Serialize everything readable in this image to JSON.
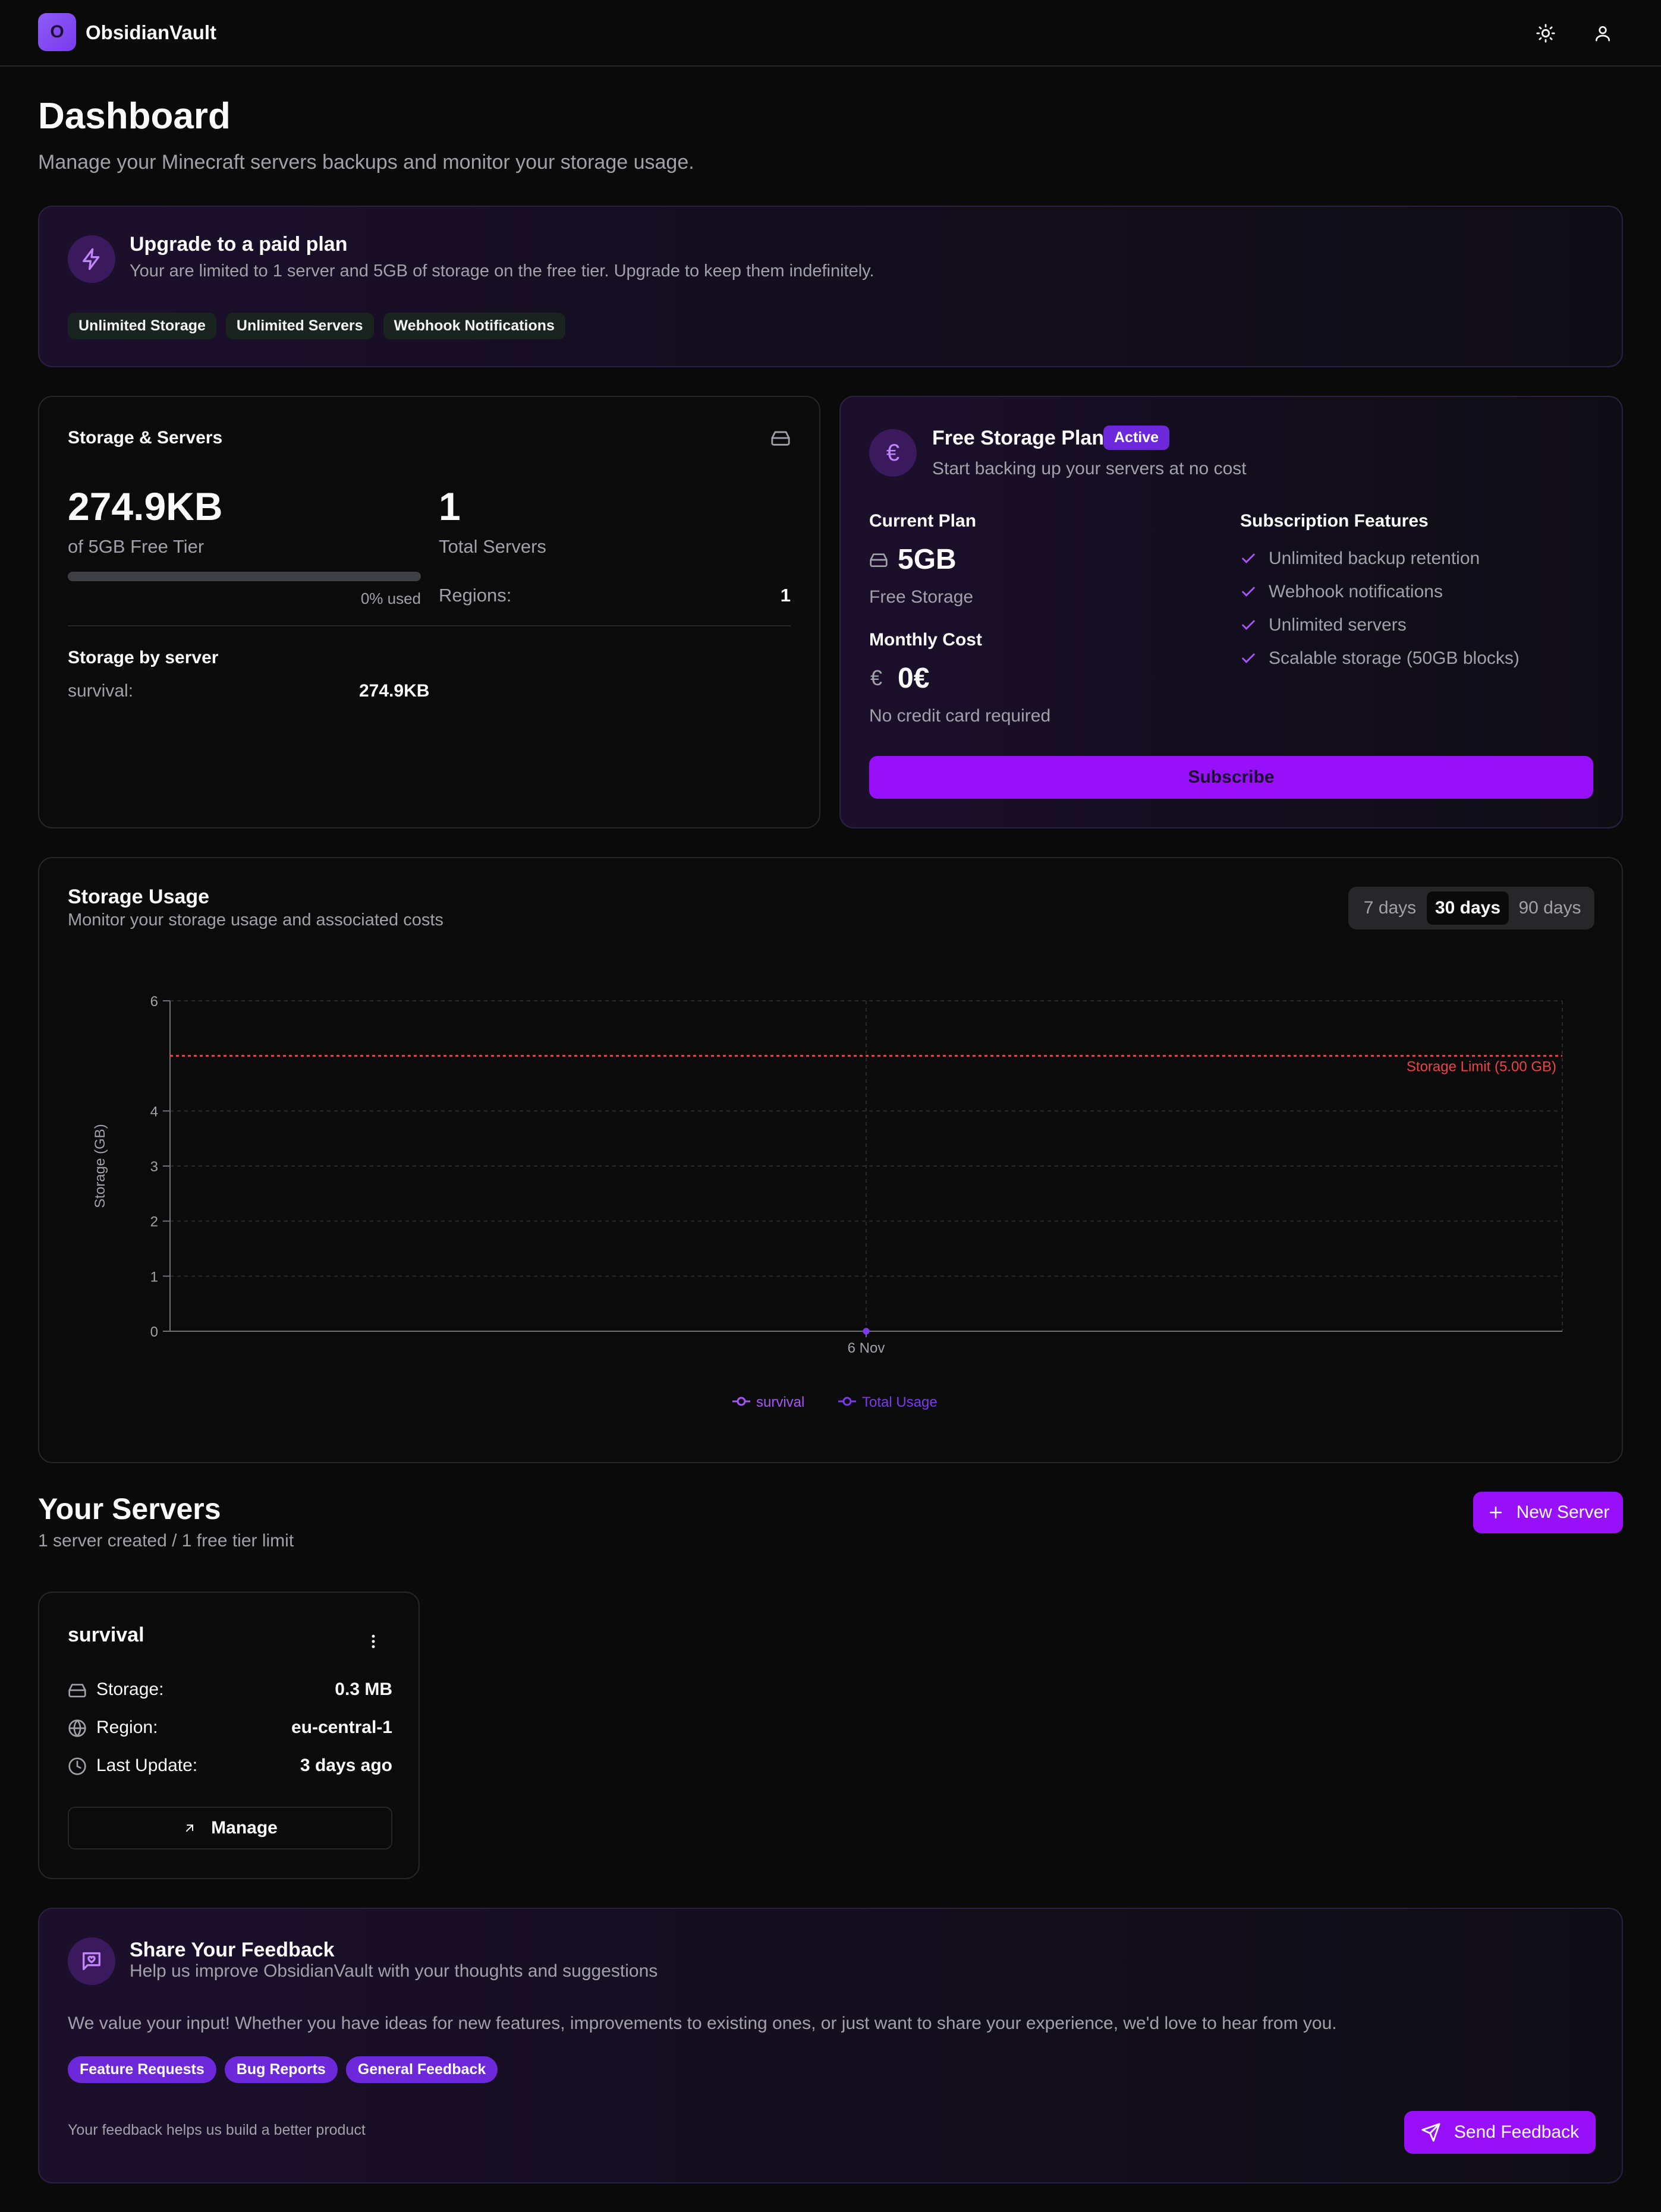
{
  "header": {
    "logo_letter": "O",
    "app_name": "ObsidianVault",
    "theme_icon": "sun-icon",
    "user_icon": "user-icon"
  },
  "page": {
    "title": "Dashboard",
    "subtitle": "Manage your Minecraft servers backups and monitor your storage usage."
  },
  "upgrade": {
    "title": "Upgrade to a paid plan",
    "description": "Your are limited to 1 server and 5GB of storage on the free tier. Upgrade to keep them indefinitely.",
    "chips": [
      "Unlimited Storage",
      "Unlimited Servers",
      "Webhook Notifications"
    ]
  },
  "storage_card": {
    "title": "Storage & Servers",
    "used": "274.9KB",
    "tier": "of 5GB Free Tier",
    "used_percent_label": "0% used",
    "used_fraction": 0.0,
    "servers_count": "1",
    "servers_label": "Total Servers",
    "regions_label": "Regions:",
    "regions_value": "1",
    "by_server_title": "Storage by server",
    "by_server": [
      {
        "name": "survival:",
        "value": "274.9KB"
      }
    ]
  },
  "plan_card": {
    "title": "Free Storage Plan",
    "badge": "Active",
    "subtitle": "Start backing up your servers at no cost",
    "current_plan_label": "Current Plan",
    "storage_value": "5GB",
    "storage_caption": "Free Storage",
    "monthly_cost_label": "Monthly Cost",
    "currency_symbol": "€",
    "cost_value": "0€",
    "cost_caption": "No credit card required",
    "features_title": "Subscription Features",
    "features": [
      "Unlimited backup retention",
      "Webhook notifications",
      "Unlimited servers",
      "Scalable storage (50GB blocks)"
    ],
    "subscribe_label": "Subscribe"
  },
  "usage": {
    "title": "Storage Usage",
    "subtitle": "Monitor your storage usage and associated costs",
    "ranges": [
      "7 days",
      "30 days",
      "90 days"
    ],
    "selected_range": "30 days"
  },
  "chart_data": {
    "type": "line",
    "ylabel": "Storage (GB)",
    "xlabel": "",
    "x": [
      "6 Nov"
    ],
    "ylim": [
      0,
      6
    ],
    "yticks": [
      0,
      1,
      2,
      3,
      4,
      6
    ],
    "series": [
      {
        "name": "survival",
        "values": [
          0.0003
        ],
        "color": "#a855f7"
      },
      {
        "name": "Total Usage",
        "values": [
          0.0003
        ],
        "color": "#7c3aed"
      }
    ],
    "limit_line": {
      "label": "Storage Limit (5.00 GB)",
      "value": 5,
      "color": "#ef4444"
    },
    "grid": true,
    "legend": "bottom-center"
  },
  "servers": {
    "title": "Your Servers",
    "subtitle": "1 server created / 1 free tier limit",
    "new_button": "New Server",
    "list": [
      {
        "name": "survival",
        "storage_label": "Storage:",
        "storage_value": "0.3 MB",
        "region_label": "Region:",
        "region_value": "eu-central-1",
        "update_label": "Last Update:",
        "update_value": "3 days ago",
        "manage_label": "Manage"
      }
    ]
  },
  "feedback": {
    "title": "Share Your Feedback",
    "subtitle": "Help us improve ObsidianVault with your thoughts and suggestions",
    "body": "We value your input! Whether you have ideas for new features, improvements to existing ones, or just want to share your experience, we'd love to hear from you.",
    "chips": [
      "Feature Requests",
      "Bug Reports",
      "General Feedback"
    ],
    "footer_note": "Your feedback helps us build a better product",
    "send_label": "Send Feedback"
  },
  "colors": {
    "accent": "#9810fa",
    "background": "#0a0a0a",
    "limit": "#ef4444"
  }
}
